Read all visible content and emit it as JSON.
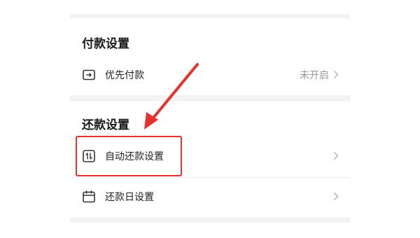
{
  "payment_settings": {
    "title": "付款设置",
    "items": [
      {
        "label": "优先付款",
        "value": "未开启",
        "icon": "wallet-icon"
      }
    ]
  },
  "repayment_settings": {
    "title": "还款设置",
    "items": [
      {
        "label": "自动还款设置",
        "icon": "auto-repay-icon"
      },
      {
        "label": "还款日设置",
        "icon": "calendar-icon"
      }
    ]
  },
  "colors": {
    "annotation": "#e8312d",
    "chevron": "#b5b5b5",
    "value_text": "#9a9a9a"
  }
}
